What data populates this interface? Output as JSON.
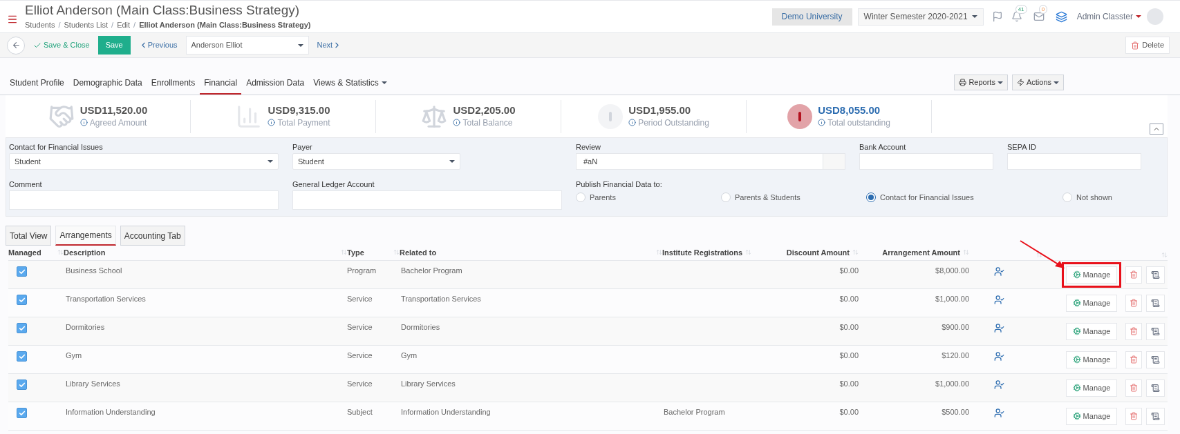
{
  "header": {
    "title": "Elliot Anderson (Main Class:Business Strategy)",
    "breadcrumb": [
      {
        "label": "Students",
        "current": false
      },
      {
        "separator": "/",
        "label": "Students List",
        "current": false
      },
      {
        "separator": "/",
        "label": "Edit",
        "current": false
      },
      {
        "separator": "/",
        "label": "Elliot Anderson (Main Class:Business Strategy)",
        "current": true
      }
    ],
    "institution": "Demo University",
    "semester": "Winter Semester 2020-2021",
    "notifications": "41",
    "messages": "0",
    "user": "Admin Classter"
  },
  "toolbar": {
    "save_close": "Save & Close",
    "save": "Save",
    "previous": "Previous",
    "student": "Anderson Elliot",
    "next": "Next",
    "delete": "Delete"
  },
  "tabs": [
    {
      "label": "Student Profile",
      "selected": false,
      "menu": false
    },
    {
      "label": "Demographic Data",
      "selected": false,
      "menu": false
    },
    {
      "label": "Enrollments",
      "selected": false,
      "menu": false
    },
    {
      "label": "Financial",
      "selected": true,
      "menu": false
    },
    {
      "label": "Admission Data",
      "selected": false,
      "menu": false
    },
    {
      "label": "Views & Statistics",
      "selected": false,
      "menu": true
    }
  ],
  "tab_actions": [
    "Reports",
    "Actions"
  ],
  "summary": [
    {
      "kind": "handshake",
      "amount": "USD11,520.00",
      "label": "Agreed Amount"
    },
    {
      "kind": "chart",
      "amount": "USD9,315.00",
      "label": "Total Payment"
    },
    {
      "kind": "scale",
      "amount": "USD2,205.00",
      "label": "Total Balance"
    },
    {
      "kind": "warning",
      "amount": "USD1,955.00",
      "label": "Period Outstanding"
    },
    {
      "kind": "alert",
      "amount": "USD8,055.00",
      "label": "Total outstanding"
    }
  ],
  "form": {
    "contact": {
      "label": "Contact for Financial Issues",
      "value": "Student"
    },
    "payer": {
      "label": "Payer",
      "value": "Student"
    },
    "review": {
      "label": "Review",
      "value": "#aN"
    },
    "bank": {
      "label": "Bank Account"
    },
    "sepa": {
      "label": "SEPA ID"
    },
    "comment": {
      "label": "Comment"
    },
    "ledger": {
      "label": "General Ledger Account"
    },
    "publish": {
      "label": "Publish Financial Data to:",
      "options": [
        {
          "label": "Parents",
          "selected": false
        },
        {
          "label": "Parents & Students",
          "selected": false
        },
        {
          "label": "Contact for Financial Issues",
          "selected": true
        },
        {
          "label": "Not shown",
          "selected": false
        }
      ]
    }
  },
  "subtabs": [
    {
      "label": "Total View",
      "selected": false
    },
    {
      "label": "Arrangements",
      "selected": true
    },
    {
      "label": "Accounting Tab",
      "selected": false
    }
  ],
  "table": {
    "columns": [
      "Managed",
      "Description",
      "Type",
      "Related to",
      "Institute Registrations",
      "Discount Amount",
      "Arrangement Amount"
    ],
    "rows": [
      {
        "managed": true,
        "description": "Business School",
        "type": "Program",
        "related": "Bachelor Program",
        "registration": "",
        "discount": "$0.00",
        "amount": "$8,000.00",
        "action": "Manage",
        "highlighted": true
      },
      {
        "managed": true,
        "description": "Transportation Services",
        "type": "Service",
        "related": "Transportation Services",
        "registration": "",
        "discount": "$0.00",
        "amount": "$1,000.00",
        "action": "Manage",
        "highlighted": false
      },
      {
        "managed": true,
        "description": "Dormitories",
        "type": "Service",
        "related": "Dormitories",
        "registration": "",
        "discount": "$0.00",
        "amount": "$900.00",
        "action": "Manage",
        "highlighted": false
      },
      {
        "managed": true,
        "description": "Gym",
        "type": "Service",
        "related": "Gym",
        "registration": "",
        "discount": "$0.00",
        "amount": "$120.00",
        "action": "Manage",
        "highlighted": false
      },
      {
        "managed": true,
        "description": "Library Services",
        "type": "Service",
        "related": "Library Services",
        "registration": "",
        "discount": "$0.00",
        "amount": "$1,000.00",
        "action": "Manage",
        "highlighted": false
      },
      {
        "managed": true,
        "description": "Information Understanding",
        "type": "Subject",
        "related": "Information Understanding",
        "registration": "Bachelor Program",
        "discount": "$0.00",
        "amount": "$500.00",
        "action": "Manage",
        "highlighted": false
      }
    ]
  }
}
